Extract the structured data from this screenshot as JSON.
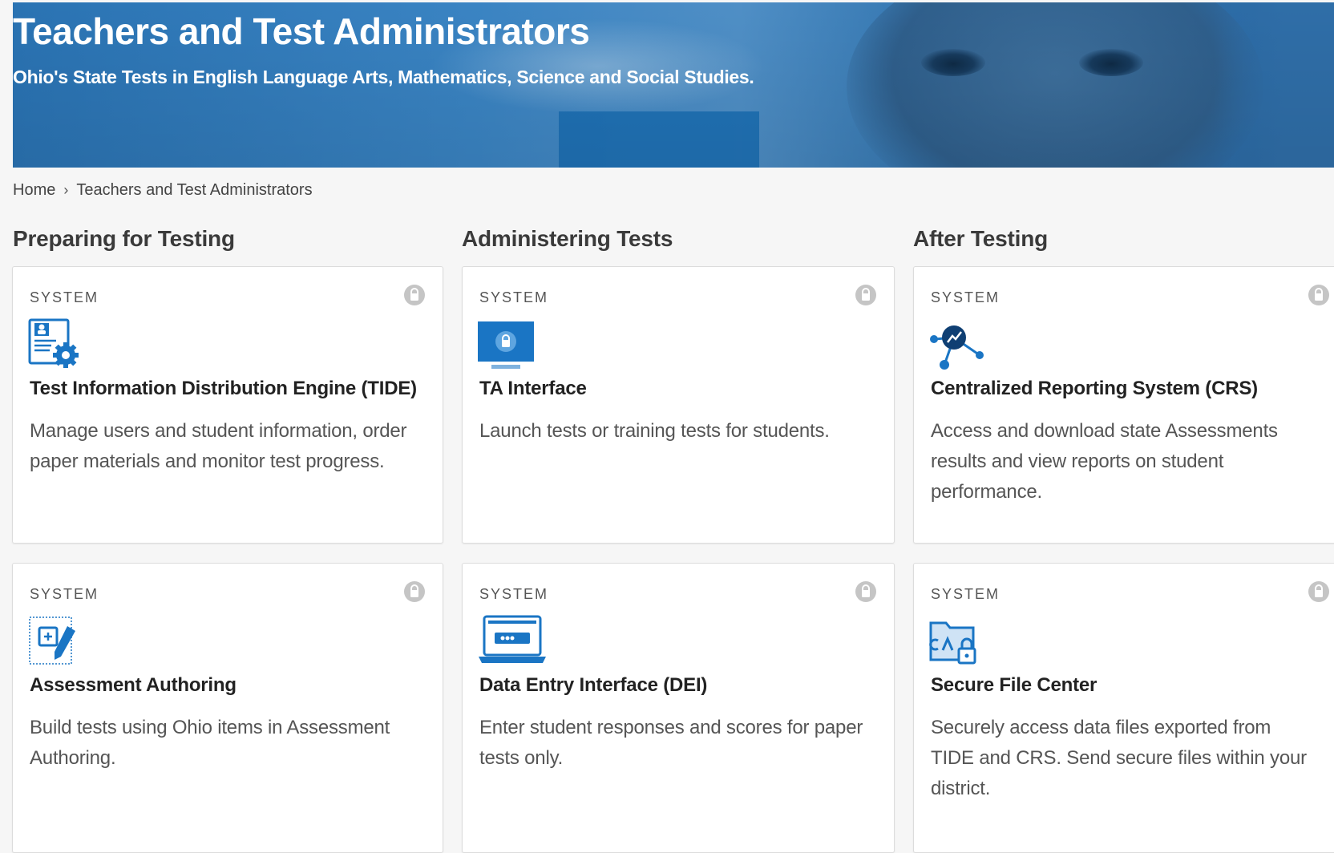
{
  "hero": {
    "title": "Teachers and Test Administrators",
    "subtitle": "Ohio's State Tests in English Language Arts, Mathematics, Science and Social Studies."
  },
  "breadcrumb": {
    "home": "Home",
    "separator": "›",
    "current": "Teachers and Test Administrators"
  },
  "columns": [
    {
      "heading": "Preparing for Testing"
    },
    {
      "heading": "Administering Tests"
    },
    {
      "heading": "After Testing"
    }
  ],
  "cards": [
    {
      "kicker": "SYSTEM",
      "icon": "tide-settings-icon",
      "title": "Test Information Distribution Engine (TIDE)",
      "description": "Manage users and student information, order paper materials and monitor test progress."
    },
    {
      "kicker": "SYSTEM",
      "icon": "ta-monitor-lock-icon",
      "title": "TA Interface",
      "description": "Launch tests or training tests for students."
    },
    {
      "kicker": "SYSTEM",
      "icon": "network-chart-icon",
      "title": "Centralized Reporting System (CRS)",
      "description": "Access and download state Assessments results and view reports on student performance."
    },
    {
      "kicker": "SYSTEM",
      "icon": "edit-authoring-icon",
      "title": "Assessment Authoring",
      "description": "Build tests using Ohio items in Assessment Authoring."
    },
    {
      "kicker": "SYSTEM",
      "icon": "laptop-entry-icon",
      "title": "Data Entry Interface (DEI)",
      "description": "Enter student responses and scores for paper tests only."
    },
    {
      "kicker": "SYSTEM",
      "icon": "secure-folder-icon",
      "title": "Secure File Center",
      "description": "Securely access data files exported from TIDE and CRS. Send secure files within your district."
    }
  ],
  "colors": {
    "hero_blue": "#2a73b3",
    "icon_blue": "#1a75c4",
    "lock_gray": "#c5c5c5"
  }
}
